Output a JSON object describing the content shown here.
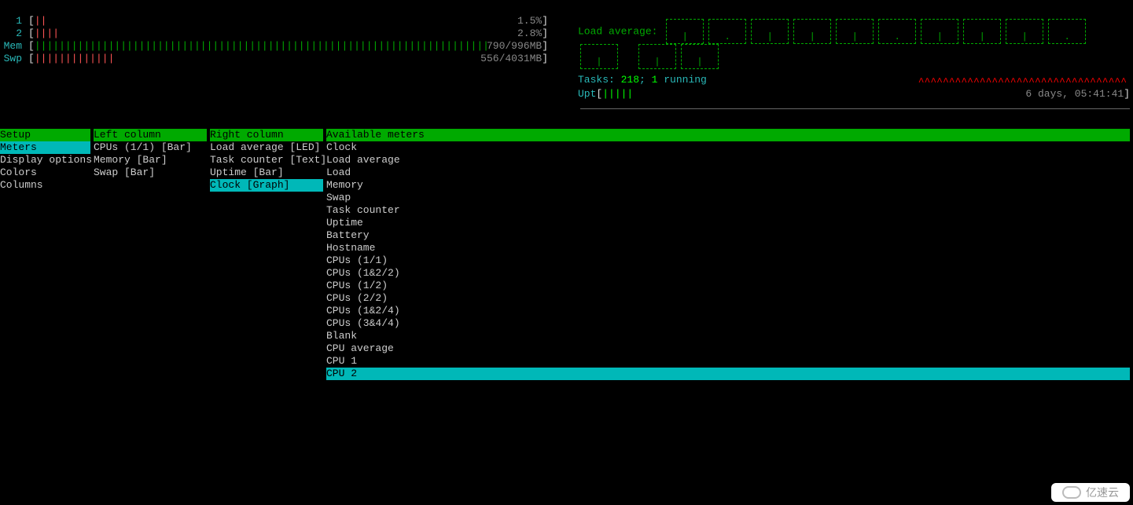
{
  "meters": {
    "cpu1": {
      "label": "1",
      "bar": "||",
      "value": "1.5%"
    },
    "cpu2": {
      "label": "2",
      "bar": "||||",
      "value": "2.8%"
    },
    "mem": {
      "label": "Mem",
      "value": "790/996MB"
    },
    "swp": {
      "label": "Swp",
      "value": "556/4031MB"
    }
  },
  "loadavg_label": "Load average:",
  "load_digits": [
    "|",
    ".",
    "|",
    "|",
    "|",
    ".",
    "|",
    "|",
    "|",
    ".",
    "|",
    "",
    "|",
    "|"
  ],
  "tasks_label": "Tasks: ",
  "tasks_count": "218",
  "tasks_sep": "; ",
  "running_count": "1",
  "running_label": " running",
  "uptime_label": "Upt",
  "uptime_bar": "|||||",
  "uptime_value": "6 days, 05:41:41",
  "red_tilde": "^^^^^^^^^^^^^^^^^^^^^^^^^^^^^^^^^^",
  "cols": {
    "setup": {
      "header": "Setup",
      "items": [
        "Meters",
        "Display options",
        "Colors",
        "Columns"
      ],
      "selected": 0
    },
    "left": {
      "header": "Left column",
      "items": [
        "CPUs (1/1) [Bar]",
        "Memory [Bar]",
        "Swap [Bar]"
      ],
      "selected": -1
    },
    "right": {
      "header": "Right column",
      "items": [
        "Load average [LED]",
        "Task counter [Text]",
        "Uptime [Bar]",
        "Clock [Graph]"
      ],
      "selected": 3
    },
    "avail": {
      "header": "Available meters",
      "items": [
        "Clock",
        "Load average",
        "Load",
        "Memory",
        "Swap",
        "Task counter",
        "Uptime",
        "Battery",
        "Hostname",
        "CPUs (1/1)",
        "CPUs (1&2/2)",
        "CPUs (1/2)",
        "CPUs (2/2)",
        "CPUs (1&2/4)",
        "CPUs (3&4/4)",
        "Blank",
        "CPU average",
        "CPU 1",
        "CPU 2"
      ],
      "selected": 18
    }
  },
  "watermark": "亿速云"
}
